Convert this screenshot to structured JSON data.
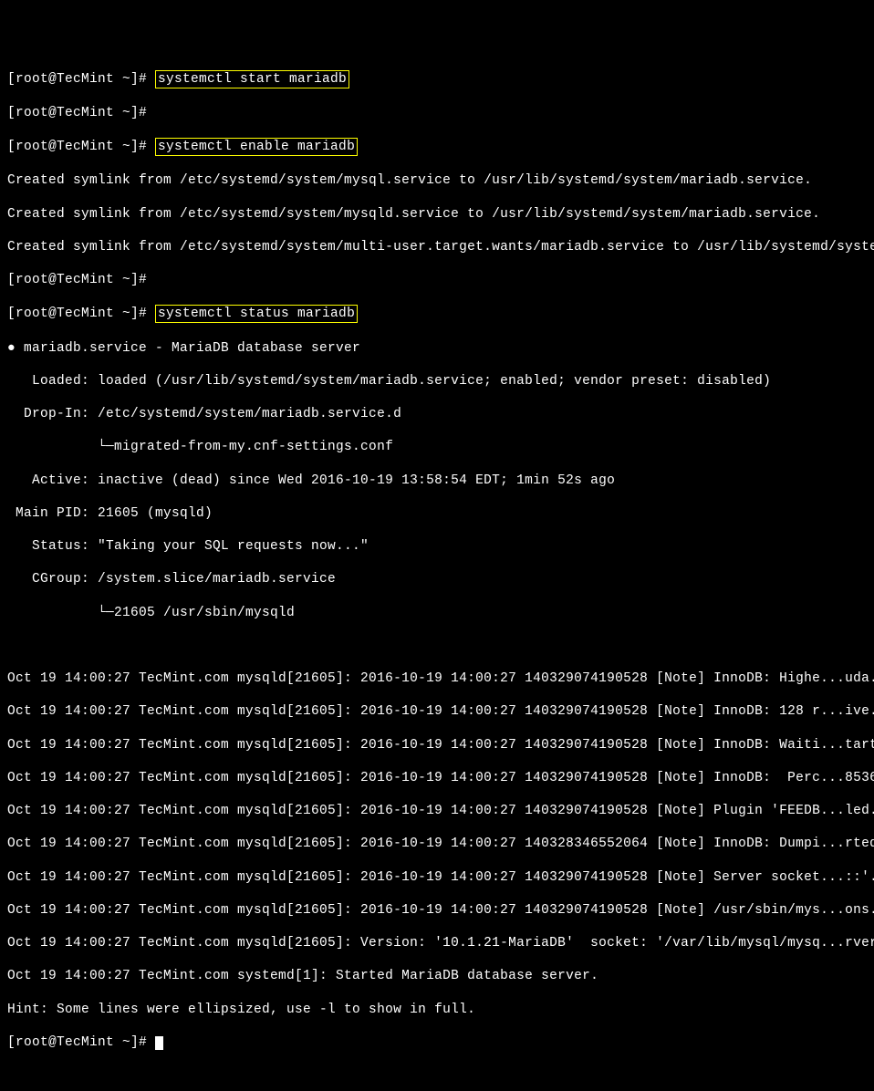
{
  "prompt": "[root@TecMint ~]# ",
  "cmd1": "systemctl start mariadb",
  "cmd2": "systemctl enable mariadb",
  "cmd3": "systemctl status mariadb",
  "symlink1": "Created symlink from /etc/systemd/system/mysql.service to /usr/lib/systemd/system/mariadb.service.",
  "symlink2": "Created symlink from /etc/systemd/system/mysqld.service to /usr/lib/systemd/system/mariadb.service.",
  "symlink3": "Created symlink from /etc/systemd/system/multi-user.target.wants/mariadb.service to /usr/lib/systemd/system/mariadb.service.",
  "status": {
    "header": "● mariadb.service - MariaDB database server",
    "loaded": "   Loaded: loaded (/usr/lib/systemd/system/mariadb.service; enabled; vendor preset: disabled)",
    "dropin": "  Drop-In: /etc/systemd/system/mariadb.service.d",
    "dropin2": "           └─migrated-from-my.cnf-settings.conf",
    "active": "   Active: inactive (dead) since Wed 2016-10-19 13:58:54 EDT; 1min 52s ago",
    "mainpid": " Main PID: 21605 (mysqld)",
    "statusl": "   Status: \"Taking your SQL requests now...\"",
    "cgroup": "   CGroup: /system.slice/mariadb.service",
    "cgroup2": "           └─21605 /usr/sbin/mysqld"
  },
  "logs": [
    "Oct 19 14:00:27 TecMint.com mysqld[21605]: 2016-10-19 14:00:27 140329074190528 [Note] InnoDB: Highe...uda.",
    "Oct 19 14:00:27 TecMint.com mysqld[21605]: 2016-10-19 14:00:27 140329074190528 [Note] InnoDB: 128 r...ive.",
    "Oct 19 14:00:27 TecMint.com mysqld[21605]: 2016-10-19 14:00:27 140329074190528 [Note] InnoDB: Waiti...tart",
    "Oct 19 14:00:27 TecMint.com mysqld[21605]: 2016-10-19 14:00:27 140329074190528 [Note] InnoDB:  Perc...8536",
    "Oct 19 14:00:27 TecMint.com mysqld[21605]: 2016-10-19 14:00:27 140329074190528 [Note] Plugin 'FEEDB...led.",
    "Oct 19 14:00:27 TecMint.com mysqld[21605]: 2016-10-19 14:00:27 140328346552064 [Note] InnoDB: Dumpi...rted",
    "Oct 19 14:00:27 TecMint.com mysqld[21605]: 2016-10-19 14:00:27 140329074190528 [Note] Server socket...::'.",
    "Oct 19 14:00:27 TecMint.com mysqld[21605]: 2016-10-19 14:00:27 140329074190528 [Note] /usr/sbin/mys...ons.",
    "Oct 19 14:00:27 TecMint.com mysqld[21605]: Version: '10.1.21-MariaDB'  socket: '/var/lib/mysql/mysq...rver",
    "Oct 19 14:00:27 TecMint.com systemd[1]: Started MariaDB database server."
  ],
  "hint": "Hint: Some lines were ellipsized, use -l to show in full."
}
